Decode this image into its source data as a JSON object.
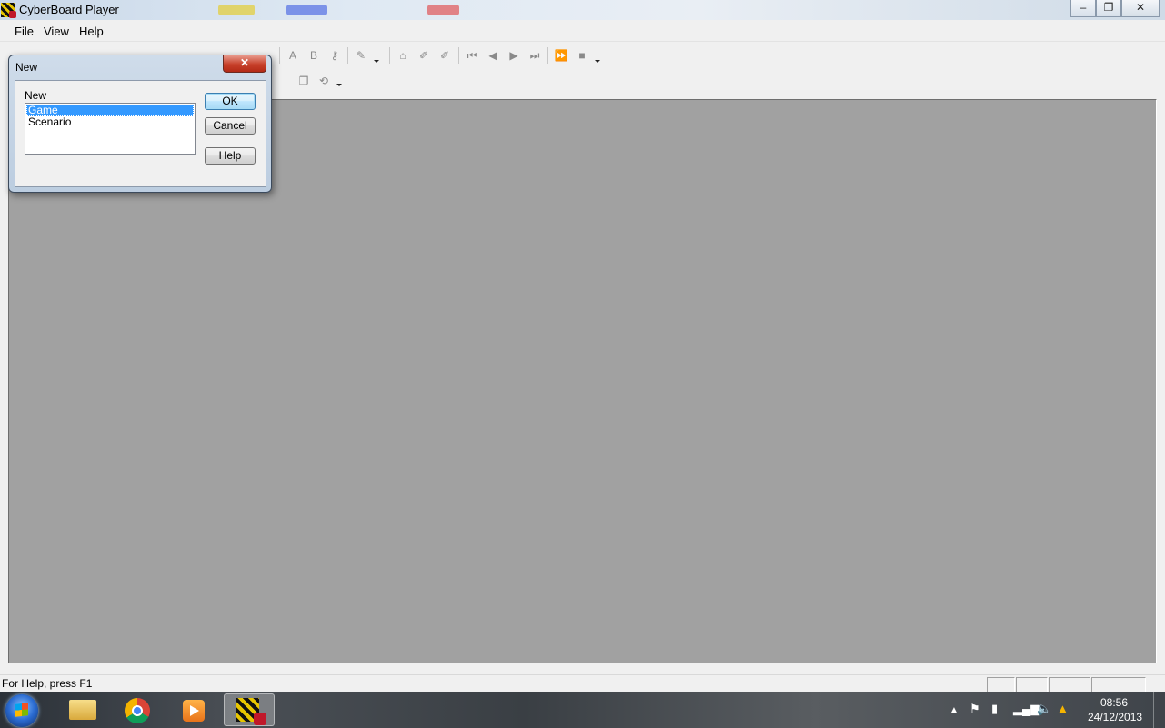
{
  "window": {
    "title": "CyberBoard Player",
    "controls": {
      "minimize": "–",
      "maximize": "❐",
      "close": "✕"
    }
  },
  "menu": {
    "items": [
      "File",
      "View",
      "Help"
    ]
  },
  "toolbar": {
    "icons": [
      "new-icon",
      "open-icon",
      "save-icon",
      "print-icon",
      "cut-icon",
      "help-icon",
      "zoom-icon",
      "text-a-icon",
      "text-b-icon",
      "key-icon",
      "move-icon",
      "home-icon",
      "record-icon",
      "record-all-icon",
      "first-icon",
      "prev-icon",
      "next-icon",
      "last-icon",
      "fast-forward-icon",
      "stop-icon",
      "copy-icon",
      "rotate-icon"
    ]
  },
  "dialog": {
    "title": "New",
    "close_label": "✕",
    "list_label": "New",
    "list_items": [
      "Game",
      "Scenario"
    ],
    "selected_index": 0,
    "buttons": {
      "ok": "OK",
      "cancel": "Cancel",
      "help": "Help"
    }
  },
  "status": {
    "text": "For Help, press F1"
  },
  "taskbar": {
    "apps": [
      "windows-explorer",
      "google-chrome",
      "media-player",
      "cyberboard-player"
    ],
    "active_app": "cyberboard-player",
    "clock": {
      "time": "08:56",
      "date": "24/12/2013"
    }
  },
  "colors": {
    "workspace": "#a1a1a1",
    "selection": "#3399ff",
    "dialog_close": "#c7402a"
  }
}
